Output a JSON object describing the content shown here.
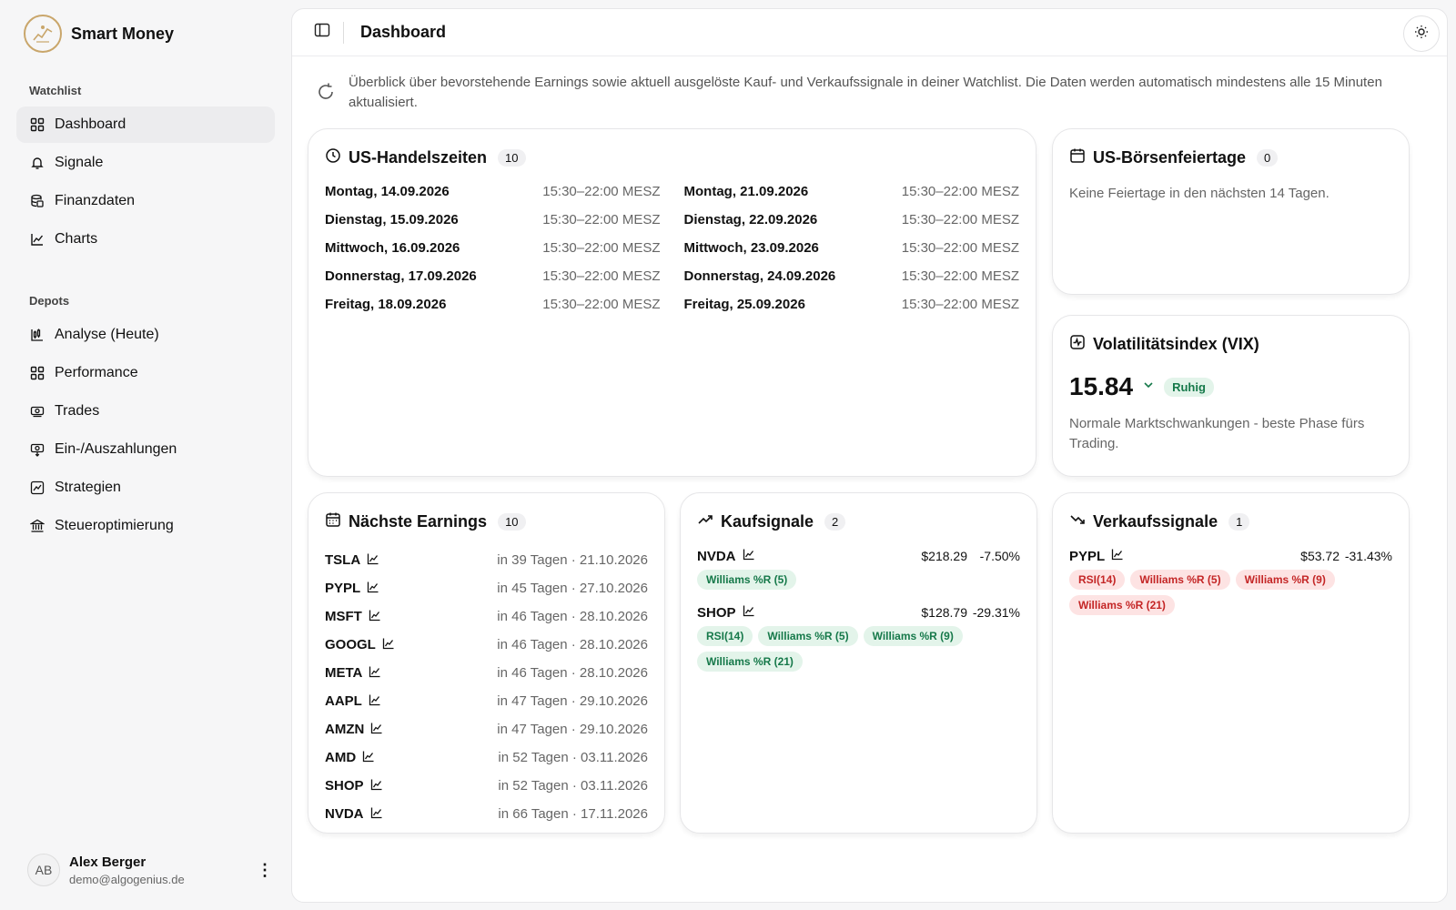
{
  "app": {
    "name": "Smart Money"
  },
  "sidebar": {
    "sections": [
      {
        "label": "Watchlist",
        "items": [
          {
            "label": "Dashboard",
            "icon": "grid-icon",
            "active": true
          },
          {
            "label": "Signale",
            "icon": "bell-icon"
          },
          {
            "label": "Finanzdaten",
            "icon": "coins-icon"
          },
          {
            "label": "Charts",
            "icon": "line-chart-icon"
          }
        ]
      },
      {
        "label": "Depots",
        "items": [
          {
            "label": "Analyse (Heute)",
            "icon": "candlestick-icon"
          },
          {
            "label": "Performance",
            "icon": "grid-icon"
          },
          {
            "label": "Trades",
            "icon": "money-icon"
          },
          {
            "label": "Ein-/Auszahlungen",
            "icon": "deposit-icon"
          },
          {
            "label": "Strategien",
            "icon": "strategy-icon"
          },
          {
            "label": "Steueroptimierung",
            "icon": "bank-icon"
          }
        ]
      }
    ],
    "user": {
      "initials": "AB",
      "name": "Alex Berger",
      "email": "demo@algogenius.de"
    }
  },
  "header": {
    "title": "Dashboard"
  },
  "intro": "Überblick über bevorstehende Earnings sowie aktuell ausgelöste Kauf- und Verkaufssignale in deiner Watchlist. Die Daten werden automatisch mindestens alle 15 Minuten aktualisiert.",
  "hours": {
    "title": "US-Handelszeiten",
    "count": "10",
    "days": [
      {
        "day": "Montag, 14.09.2026",
        "time": "15:30–22:00 MESZ"
      },
      {
        "day": "Dienstag, 15.09.2026",
        "time": "15:30–22:00 MESZ"
      },
      {
        "day": "Mittwoch, 16.09.2026",
        "time": "15:30–22:00 MESZ"
      },
      {
        "day": "Donnerstag, 17.09.2026",
        "time": "15:30–22:00 MESZ"
      },
      {
        "day": "Freitag, 18.09.2026",
        "time": "15:30–22:00 MESZ"
      },
      {
        "day": "Montag, 21.09.2026",
        "time": "15:30–22:00 MESZ"
      },
      {
        "day": "Dienstag, 22.09.2026",
        "time": "15:30–22:00 MESZ"
      },
      {
        "day": "Mittwoch, 23.09.2026",
        "time": "15:30–22:00 MESZ"
      },
      {
        "day": "Donnerstag, 24.09.2026",
        "time": "15:30–22:00 MESZ"
      },
      {
        "day": "Freitag, 25.09.2026",
        "time": "15:30–22:00 MESZ"
      }
    ]
  },
  "holidays": {
    "title": "US-Börsenfeiertage",
    "count": "0",
    "text": "Keine Feiertage in den nächsten 14 Tagen."
  },
  "vix": {
    "title": "Volatilitätsindex (VIX)",
    "value": "15.84",
    "badge": "Ruhig",
    "text": "Normale Marktschwankungen - beste Phase fürs Trading."
  },
  "earnings": {
    "title": "Nächste Earnings",
    "count": "10",
    "items": [
      {
        "symbol": "TSLA",
        "when": "in 39 Tagen · 21.10.2026"
      },
      {
        "symbol": "PYPL",
        "when": "in 45 Tagen · 27.10.2026"
      },
      {
        "symbol": "MSFT",
        "when": "in 46 Tagen · 28.10.2026"
      },
      {
        "symbol": "GOOGL",
        "when": "in 46 Tagen · 28.10.2026"
      },
      {
        "symbol": "META",
        "when": "in 46 Tagen · 28.10.2026"
      },
      {
        "symbol": "AAPL",
        "when": "in 47 Tagen · 29.10.2026"
      },
      {
        "symbol": "AMZN",
        "when": "in 47 Tagen · 29.10.2026"
      },
      {
        "symbol": "AMD",
        "when": "in 52 Tagen · 03.11.2026"
      },
      {
        "symbol": "SHOP",
        "when": "in 52 Tagen · 03.11.2026"
      },
      {
        "symbol": "NVDA",
        "when": "in 66 Tagen · 17.11.2026"
      }
    ]
  },
  "buy": {
    "title": "Kaufsignale",
    "count": "2",
    "items": [
      {
        "symbol": "NVDA",
        "price": "$218.29",
        "change": "-7.50%",
        "tags": [
          "Williams %R (5)"
        ]
      },
      {
        "symbol": "SHOP",
        "price": "$128.79",
        "change": "-29.31%",
        "tags": [
          "RSI(14)",
          "Williams %R (5)",
          "Williams %R (9)",
          "Williams %R (21)"
        ]
      }
    ]
  },
  "sell": {
    "title": "Verkaufssignale",
    "count": "1",
    "items": [
      {
        "symbol": "PYPL",
        "price": "$53.72",
        "change": "-31.43%",
        "tags": [
          "RSI(14)",
          "Williams %R (5)",
          "Williams %R (9)",
          "Williams %R (21)"
        ]
      }
    ]
  }
}
